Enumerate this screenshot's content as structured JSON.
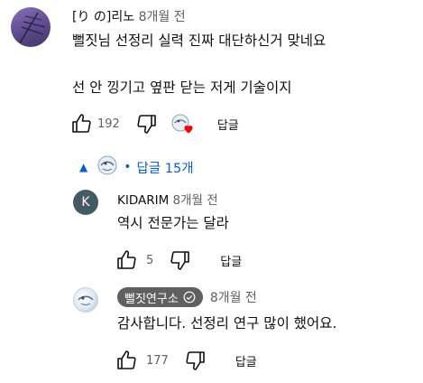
{
  "comment": {
    "author": "[り の]리노",
    "time": "8개월 전",
    "line1": "뻘짓님 선정리 실력 진짜 대단하신거 맞네요",
    "line2": "선 안 낑기고 옆판 닫는 저게 기술이지",
    "likes": "192",
    "reply_label": "답글"
  },
  "replies_toggle": {
    "arrow": "▲",
    "dot": "•",
    "label": "답글 15개"
  },
  "reply1": {
    "avatar_letter": "K",
    "author": "KIDARIM",
    "time": "8개월 전",
    "text": "역시 전문가는 달라",
    "likes": "5",
    "reply_label": "답글"
  },
  "reply2": {
    "author_badge": "뻘짓연구소",
    "time": "8개월 전",
    "text": "감사합니다. 선정리 연구 많이 했어요.",
    "likes": "177",
    "reply_label": "답글"
  },
  "colors": {
    "link_blue": "#065fd4",
    "heart_red": "#ff0000",
    "meta_gray": "#606060"
  }
}
